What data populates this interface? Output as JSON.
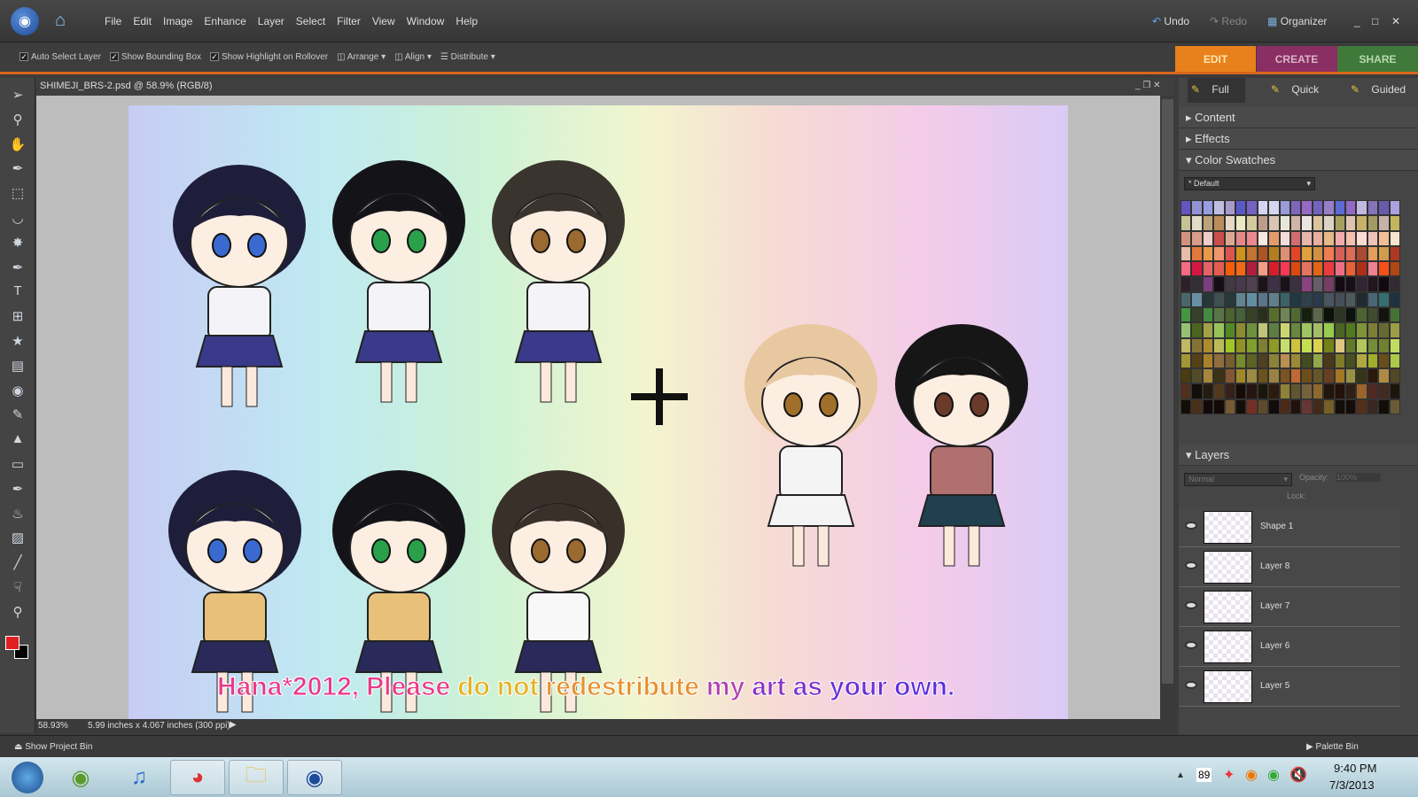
{
  "app": {
    "menu": [
      "File",
      "Edit",
      "Image",
      "Enhance",
      "Layer",
      "Select",
      "Filter",
      "View",
      "Window",
      "Help"
    ],
    "undo": "Undo",
    "redo": "Redo",
    "organizer": "Organizer"
  },
  "options": {
    "auto_select": "Auto Select Layer",
    "bounding_box": "Show Bounding Box",
    "highlight": "Show Highlight on Rollover",
    "arrange": "Arrange",
    "align": "Align",
    "distribute": "Distribute"
  },
  "tabs": [
    {
      "label": "EDIT",
      "color": "#e8811c"
    },
    {
      "label": "CREATE",
      "color": "#8a2f63"
    },
    {
      "label": "SHARE",
      "color": "#3f7a3a"
    }
  ],
  "modes": [
    "Full",
    "Quick",
    "Guided"
  ],
  "document": {
    "title": "SHIMEJI_BRS-2.psd @ 58.9% (RGB/8)",
    "zoom": "58.93%",
    "size": "5.99 inches x 4.067 inches (300 ppi)",
    "watermark": [
      "Hana*2012,",
      "Please",
      "do",
      "not",
      "redestribute",
      "my",
      "art",
      "as",
      "your",
      "own."
    ]
  },
  "panels": {
    "content": "Content",
    "effects": "Effects",
    "swatches": "Color Swatches",
    "swatch_set": "* Default",
    "layers": "Layers",
    "blend": "Normal",
    "opacity_label": "Opacity:",
    "opacity": "100%",
    "lock": "Lock:"
  },
  "layers": [
    "Shape 1",
    "Layer 8",
    "Layer 7",
    "Layer 6",
    "Layer 5"
  ],
  "bottom": {
    "project_bin": "Show Project Bin",
    "palette_bin": "Palette Bin"
  },
  "taskbar": {
    "time": "9:40 PM",
    "date": "7/3/2013",
    "tray_badge": "89"
  }
}
